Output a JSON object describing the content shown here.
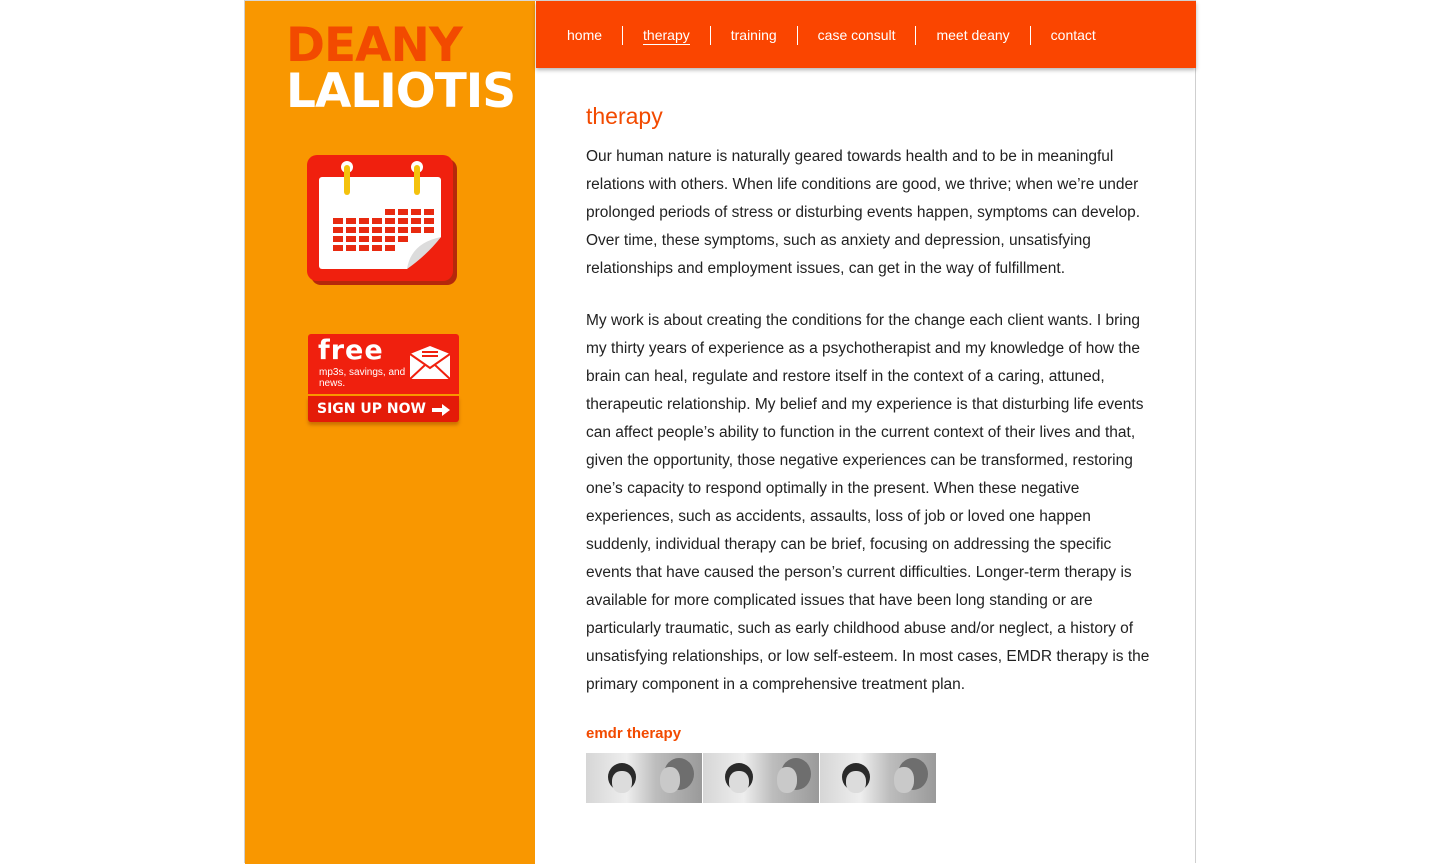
{
  "brand": {
    "line1": "DEANY",
    "line2": "LALIOTIS"
  },
  "nav": {
    "items": [
      {
        "label": "home"
      },
      {
        "label": "therapy"
      },
      {
        "label": "training"
      },
      {
        "label": "case consult"
      },
      {
        "label": "meet deany"
      },
      {
        "label": "contact"
      }
    ],
    "active": "therapy"
  },
  "sidebar": {
    "calendar_icon": "calendar-icon",
    "promo": {
      "headline": "free",
      "subtext": "mp3s, savings, and news.",
      "cta": "SIGN UP NOW",
      "icons": [
        "envelope-icon",
        "arrow-right-icon"
      ]
    }
  },
  "main": {
    "title": "therapy",
    "paragraphs": [
      "Our human nature is naturally geared towards health and to be in meaningful relations with others. When life conditions are good, we thrive; when we’re under prolonged periods of stress or disturbing events happen, symptoms can develop. Over time, these symptoms, such as anxiety and depression, unsatisfying relationships and employment issues, can get in the way of fulfillment.",
      "My work is about creating the conditions for the change each client wants. I bring my thirty years of experience as a psychotherapist and my knowledge of how the brain can heal, regulate and restore itself in the context of a caring, attuned, therapeutic relationship. My belief and my experience is that disturbing life events can affect people’s ability to function in the current context of their lives and that, given the opportunity, those negative experiences can be transformed, restoring one’s capacity to respond optimally in the present. When these negative experiences, such as accidents, assaults, loss of job or loved one happen suddenly, individual therapy can be brief, focusing on addressing the specific events that have caused the person’s current difficulties. Longer-term therapy is available for more complicated issues that have been long standing or are particularly traumatic, such as early childhood abuse and/or neglect, a history of unsatisfying relationships, or low self-esteem. In most cases, EMDR therapy is the primary component in a comprehensive treatment plan."
    ],
    "subheading": "emdr therapy",
    "photo_count": 3
  },
  "colors": {
    "sidebar": "#f99700",
    "nav": "#fa4500",
    "accent": "#f24a00",
    "promo_red": "#f0200e"
  }
}
